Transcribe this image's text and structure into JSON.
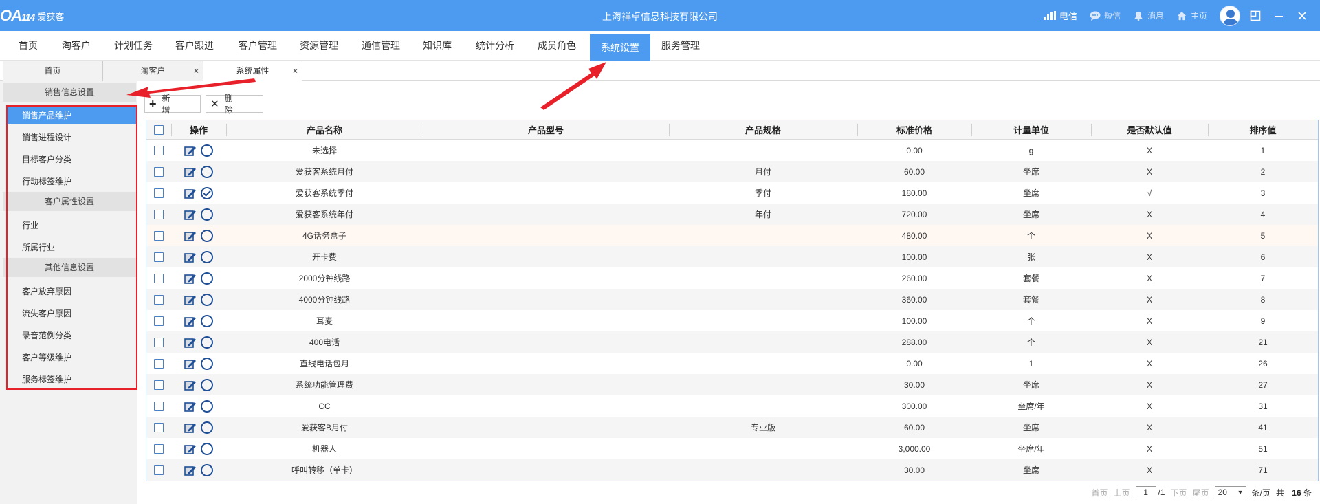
{
  "header": {
    "logo_mark": "OA",
    "logo_num": "114",
    "logo_text": "爱获客",
    "company": "上海祥卓信息科技有限公司",
    "telecom": "电信",
    "sms": "短信",
    "messages": "消息",
    "home": "主页"
  },
  "nav": [
    "首页",
    "淘客户",
    "计划任务",
    "客户跟进",
    "客户管理",
    "资源管理",
    "通信管理",
    "知识库",
    "统计分析",
    "成员角色",
    "系统设置",
    "服务管理"
  ],
  "nav_active": "系统设置",
  "tabs": [
    "首页",
    "淘客户",
    "系统属性"
  ],
  "tab_close": "×",
  "sidebar": {
    "groups": [
      "销售信息设置",
      "客户属性设置",
      "其他信息设置"
    ],
    "items": [
      "销售产品维护",
      "销售进程设计",
      "目标客户分类",
      "行动标签维护",
      "行业",
      "所属行业",
      "客户放弃原因",
      "流失客户原因",
      "录音范例分类",
      "客户等级维护",
      "服务标签维护"
    ],
    "active": "销售产品维护"
  },
  "toolbar": {
    "add_icon": "+",
    "add_label": "新 增",
    "delete_icon": "✕",
    "delete_label": "删 除"
  },
  "table": {
    "columns": [
      "操作",
      "产品名称",
      "产品型号",
      "产品规格",
      "标准价格",
      "计量单位",
      "是否默认值",
      "排序值"
    ],
    "rows": [
      [
        "未选择",
        "",
        "",
        "0.00",
        "g",
        "X",
        "1"
      ],
      [
        "爱获客系统月付",
        "",
        "月付",
        "60.00",
        "坐席",
        "X",
        "2"
      ],
      [
        "爱获客系统季付",
        "",
        "季付",
        "180.00",
        "坐席",
        "√",
        "3"
      ],
      [
        "爱获客系统年付",
        "",
        "年付",
        "720.00",
        "坐席",
        "X",
        "4"
      ],
      [
        "4G话务盒子",
        "",
        "",
        "480.00",
        "个",
        "X",
        "5"
      ],
      [
        "开卡费",
        "",
        "",
        "100.00",
        "张",
        "X",
        "6"
      ],
      [
        "2000分钟线路",
        "",
        "",
        "260.00",
        "套餐",
        "X",
        "7"
      ],
      [
        "4000分钟线路",
        "",
        "",
        "360.00",
        "套餐",
        "X",
        "8"
      ],
      [
        "耳麦",
        "",
        "",
        "100.00",
        "个",
        "X",
        "9"
      ],
      [
        "400电话",
        "",
        "",
        "288.00",
        "个",
        "X",
        "21"
      ],
      [
        "直线电话包月",
        "",
        "",
        "0.00",
        "1",
        "X",
        "26"
      ],
      [
        "系统功能管理费",
        "",
        "",
        "30.00",
        "坐席",
        "X",
        "27"
      ],
      [
        "CC",
        "",
        "",
        "300.00",
        "坐席/年",
        "X",
        "31"
      ],
      [
        "爱获客B月付",
        "",
        "专业版",
        "60.00",
        "坐席",
        "X",
        "41"
      ],
      [
        "机器人",
        "",
        "",
        "3,000.00",
        "坐席/年",
        "X",
        "51"
      ],
      [
        "呼叫转移（单卡）",
        "",
        "",
        "30.00",
        "坐席",
        "X",
        "71"
      ]
    ],
    "default_row": 2
  },
  "pager": {
    "first": "首页",
    "prev": "上页",
    "page": "1",
    "total_pages": "/1",
    "next": "下页",
    "last": "尾页",
    "page_size": "20",
    "per_page": "条/页",
    "total_prefix": "共",
    "total": "16",
    "total_suffix": "条"
  },
  "colors": {
    "accent": "#4d9bf0",
    "highlight_border": "#e8202a",
    "arrow": "#e8202a"
  }
}
